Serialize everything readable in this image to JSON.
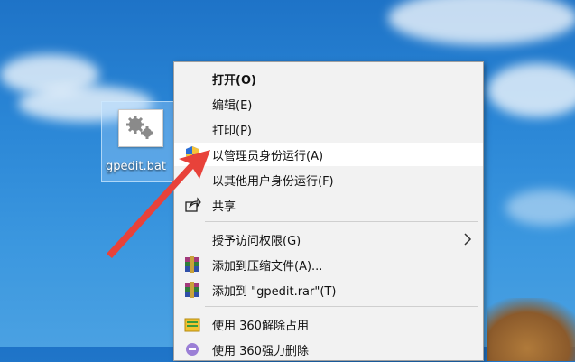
{
  "desktop_icon": {
    "label": "gpedit.bat"
  },
  "context_menu": {
    "items": [
      {
        "label": "打开(O)"
      },
      {
        "label": "编辑(E)"
      },
      {
        "label": "打印(P)"
      },
      {
        "label": "以管理员身份运行(A)"
      },
      {
        "label": "以其他用户身份运行(F)"
      },
      {
        "label": "共享"
      },
      {
        "label": "授予访问权限(G)"
      },
      {
        "label": "添加到压缩文件(A)..."
      },
      {
        "label": "添加到 \"gpedit.rar\"(T)"
      },
      {
        "label": "使用 360解除占用"
      },
      {
        "label": "使用 360强力删除"
      }
    ]
  },
  "colors": {
    "annotation_arrow": "#e8423a",
    "hover_bg": "#ffffff"
  }
}
